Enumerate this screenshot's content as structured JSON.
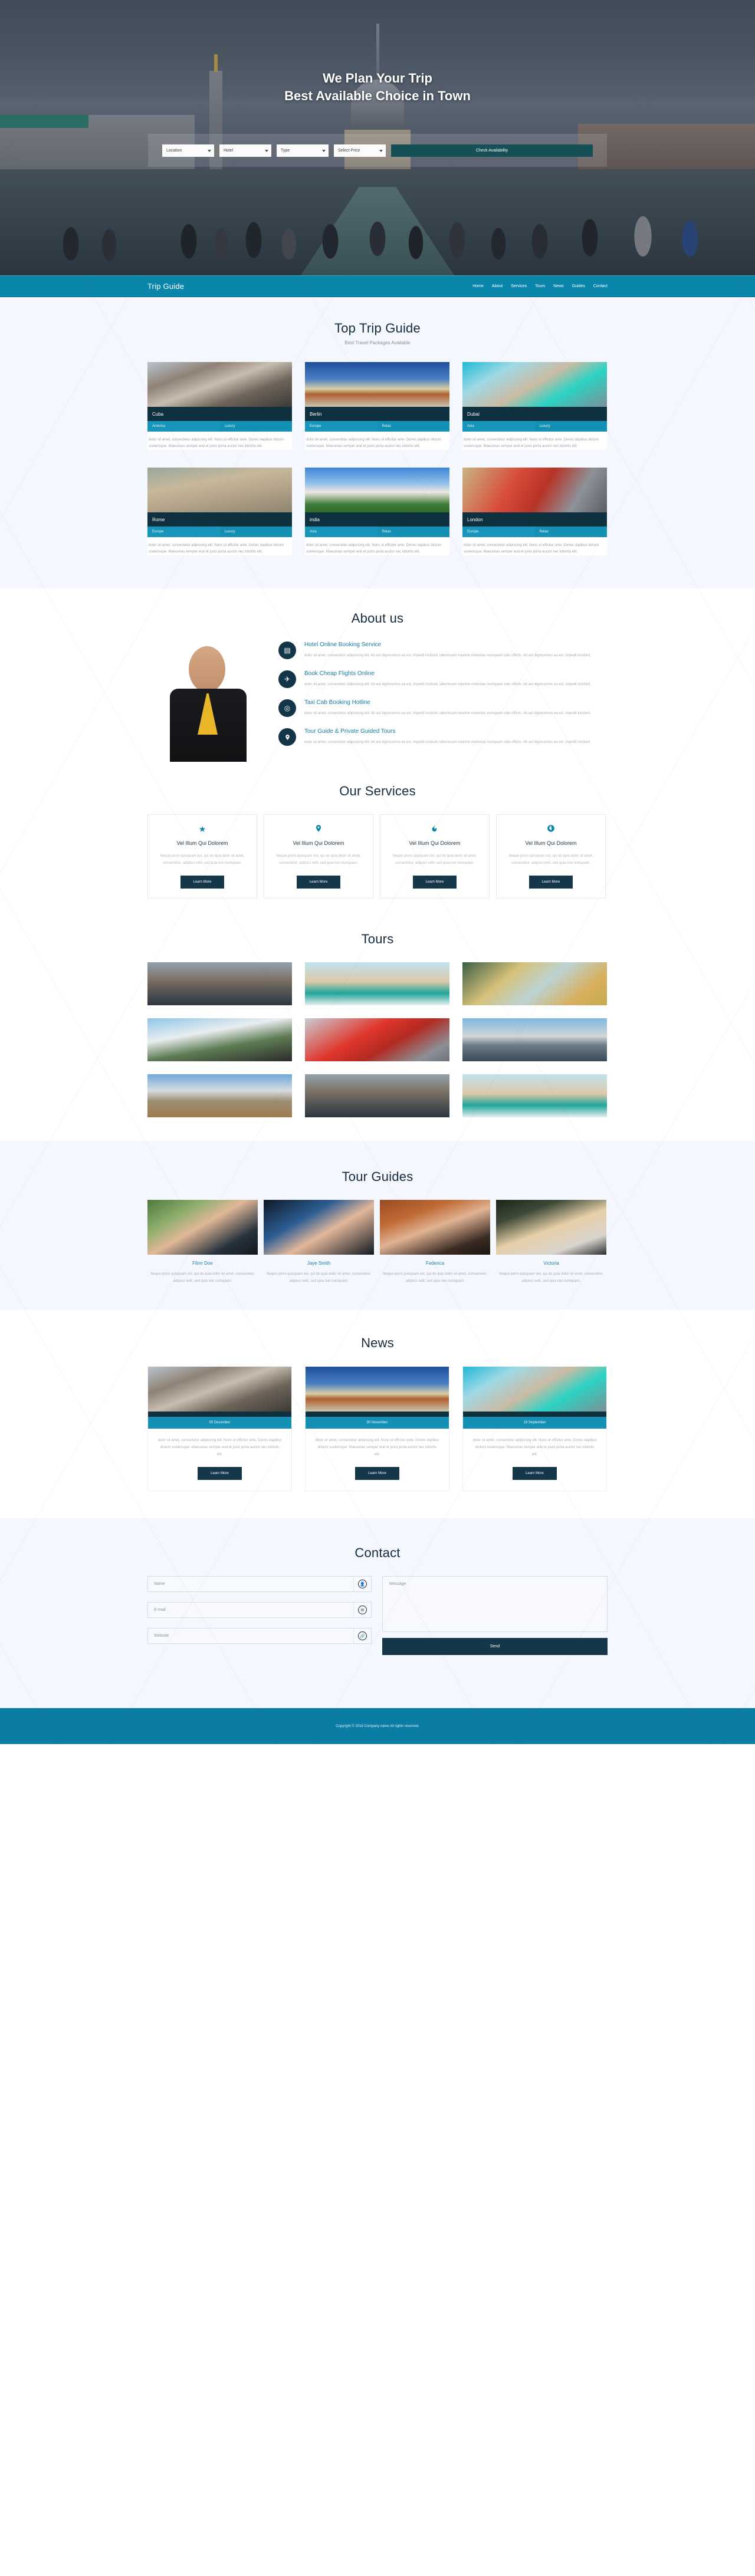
{
  "hero": {
    "title_line1": "We Plan Your Trip",
    "title_line2": "Best Available Choice in Town",
    "search": {
      "location": "Location",
      "hotel": "Hotel",
      "type": "Type",
      "price": "Select Price",
      "button": "Check Availability"
    }
  },
  "nav": {
    "brand": "Trip Guide",
    "links": [
      {
        "label": "Home"
      },
      {
        "label": "About"
      },
      {
        "label": "Services"
      },
      {
        "label": "Tours"
      },
      {
        "label": "News"
      },
      {
        "label": "Guides"
      },
      {
        "label": "Contact"
      }
    ]
  },
  "top_trip": {
    "title": "Top Trip Guide",
    "subtitle": "Best Travel Packages Available",
    "body": "dolor sit amet, consectetur adipiscing elit. Nunc ut efficitur ante. Donec dapibus dictum scelerisque. Maecenas semper erat et justo porta auctor nec lobortis elit.",
    "cards": [
      {
        "name": "Cuba",
        "tag1": "America",
        "tag2": "Luxury",
        "img": "img-cuba"
      },
      {
        "name": "Berlin",
        "tag1": "Europe",
        "tag2": "Relax",
        "img": "img-berlin"
      },
      {
        "name": "Dubai",
        "tag1": "Asia",
        "tag2": "Luxury",
        "img": "img-dubai"
      },
      {
        "name": "Rome",
        "tag1": "Europe",
        "tag2": "Luxury",
        "img": "img-rome"
      },
      {
        "name": "india",
        "tag1": "Asia",
        "tag2": "Relax",
        "img": "img-india"
      },
      {
        "name": "London",
        "tag1": "Europe",
        "tag2": "Relax",
        "img": "img-london"
      }
    ]
  },
  "about": {
    "title": "About us",
    "items": [
      {
        "icon": "hotel-building-icon",
        "glyph": "☰",
        "heading": "Hotel Online Booking Service",
        "body": "dolor sit amet, consectetur adipisicing elit. Ab aut dignissimos ea est, impedit incidunt, laboriosam maxime molestias numquam odio officiis. Ab aut dignissimos ea est, impedit incidunt."
      },
      {
        "icon": "airplane-icon",
        "glyph": "✈",
        "heading": "Book Cheap Flights Online",
        "body": "dolor sit amet, consectetur adipisicing elit. Ab aut dignissimos ea est, impedit incidunt, laboriosam maxime molestias numquam odio officiis. Ab aut dignissimos ea est, impedit incidunt."
      },
      {
        "icon": "taxi-clock-icon",
        "glyph": "◎",
        "heading": "Taxi Cab Booking Hotline",
        "body": "dolor sit amet, consectetur adipisicing elit. Ab aut dignissimos ea est, impedit incidunt, laboriosam maxime molestias numquam odio officiis. Ab aut dignissimos ea est, impedit incidunt."
      },
      {
        "icon": "map-pin-icon",
        "glyph": "⬤",
        "heading": "Tour Guide & Private Guided Tours",
        "body": "dolor sit amet, consectetur adipisicing elit. Ab aut dignissimos ea est, impedit incidunt, laboriosam maxime molestias numquam odio officiis. Ab aut dignissimos ea est, impedit incidunt."
      }
    ]
  },
  "services": {
    "title": "Our Services",
    "body": "Neque porro quisquam est, qui do quia dolor sit amet, consectetur, adipisci velit, sed quia non numquam.",
    "cta": "Learn More",
    "cards": [
      {
        "icon": "star-icon",
        "glyph": "★",
        "heading": "Vel Illum Qui Dolorem"
      },
      {
        "icon": "map-pin-icon",
        "glyph": "⬤",
        "heading": "Vel Illum Qui Dolorem"
      },
      {
        "icon": "flame-icon",
        "glyph": "◉",
        "heading": "Vel Illum Qui Dolorem"
      },
      {
        "icon": "globe-icon",
        "glyph": "◔",
        "heading": "Vel Illum Qui Dolorem"
      }
    ]
  },
  "tours": {
    "title": "Tours",
    "cells": [
      {
        "img": "img-stpauls"
      },
      {
        "img": "img-monaco"
      },
      {
        "img": "img-van"
      },
      {
        "img": "img-selfie"
      },
      {
        "img": "img-bus"
      },
      {
        "img": "img-tower"
      },
      {
        "img": "img-palace"
      },
      {
        "img": "img-stpauls"
      },
      {
        "img": "img-monaco"
      }
    ]
  },
  "guides": {
    "title": "Tour Guides",
    "body": "Neque porro quisquam est, qui do quia dolor sit amet, consectetur, adipisci velit, sed quia non numquam.",
    "people": [
      {
        "name": "Filmr Doe",
        "img": "img-g1"
      },
      {
        "name": "Jaye Smith",
        "img": "img-g2"
      },
      {
        "name": "Federica",
        "img": "img-g3"
      },
      {
        "name": "Victoria",
        "img": "img-g4"
      }
    ]
  },
  "news": {
    "title": "News",
    "body": "dolor sit amet, consectetur adipiscing elit. Nunc ut efficitur ante. Donec dapibus dictum scelerisque. Maecenas semper erat et justo porta auctor nec lobortis elit.",
    "cta": "Learn More",
    "items": [
      {
        "date": "05 December",
        "img": "img-cuba"
      },
      {
        "date": "30 November",
        "img": "img-berlin"
      },
      {
        "date": "19 September",
        "img": "img-dubai"
      }
    ]
  },
  "contact": {
    "title": "Contact",
    "name_placeholder": "Name",
    "email_placeholder": "E-mail",
    "website_placeholder": "Website",
    "message_placeholder": "Message",
    "send_label": "Send",
    "icons": {
      "name": "user-icon",
      "email": "envelope-icon",
      "website": "link-icon"
    }
  },
  "footer": {
    "copyright": "Copyright © 2016 Company name All rights reserved."
  },
  "colors": {
    "nav_blue": "#0b86ab",
    "dark_navy": "#0e303f",
    "tag_blue": "#1590b5",
    "btn_navy": "#14374a",
    "link_blue": "#187ba3",
    "ghost_bg": "#f4f7fe"
  }
}
